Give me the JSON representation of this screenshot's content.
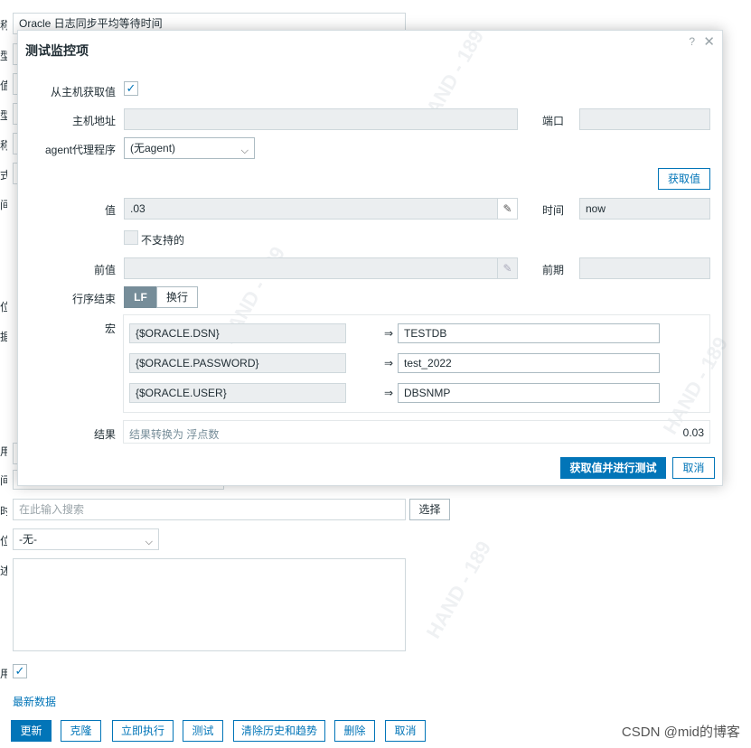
{
  "background": {
    "item_name_value": "Oracle 日志同步平均等待时间",
    "side_labels": [
      "称",
      "型",
      "值",
      "型",
      "称",
      "式",
      "间",
      "",
      "位",
      "据",
      "",
      "用",
      "间",
      "时",
      "位",
      "述",
      "用"
    ],
    "search_placeholder": "在此输入搜索",
    "select_button": "选择",
    "select_value": "-无-",
    "latest_data_link": "最新数据",
    "buttons": {
      "update": "更新",
      "clone": "克隆",
      "execute_now": "立即执行",
      "test": "测试",
      "clear_history": "清除历史和趋势",
      "delete": "删除",
      "cancel": "取消"
    }
  },
  "modal": {
    "title": "测试监控项",
    "help_icon": "?",
    "close_icon": "✕",
    "get_from_host_label": "从主机获取值",
    "host_address_label": "主机地址",
    "port_label": "端口",
    "agent_proxy_label": "agent代理程序",
    "agent_proxy_value": "(无agent)",
    "get_value_button": "获取值",
    "value_label": "值",
    "value": ".03",
    "time_label": "时间",
    "time_value": "now",
    "not_supported_label": "不支持的",
    "prev_value_label": "前值",
    "prev_time_label": "前期",
    "eol_label": "行序结束",
    "eol_options": [
      "LF",
      "换行"
    ],
    "macros_label": "宏",
    "macros": [
      {
        "name": "{$ORACLE.DSN}",
        "value": "TESTDB"
      },
      {
        "name": "{$ORACLE.PASSWORD}",
        "value": "test_2022"
      },
      {
        "name": "{$ORACLE.USER}",
        "value": "DBSNMP"
      }
    ],
    "arrow_symbol": "⇒",
    "result_label": "结果",
    "result_text": "结果转换为 浮点数",
    "result_value": "0.03",
    "get_and_test_button": "获取值并进行测试",
    "cancel_button": "取消"
  },
  "watermark_text": "HAND - 189",
  "csdn_credit": "CSDN @mid的博客",
  "colors": {
    "accent": "#0275b8",
    "segment_active": "#768d99"
  }
}
